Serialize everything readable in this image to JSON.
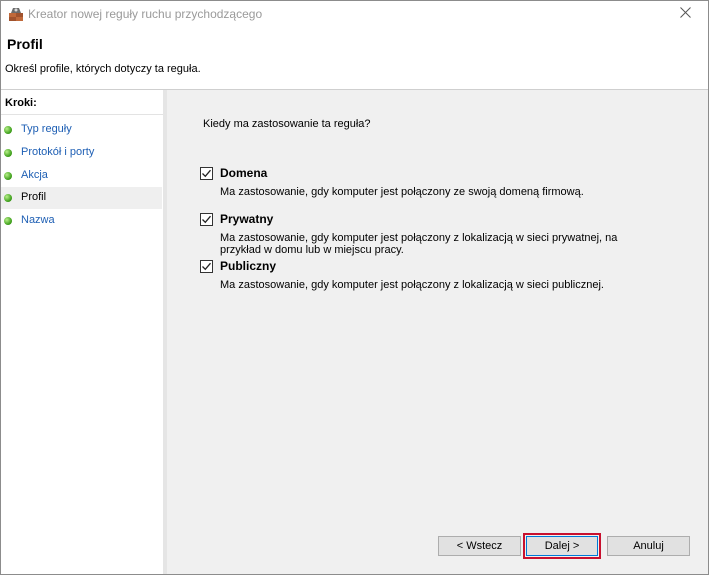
{
  "window": {
    "title": "Kreator nowej reguły ruchu przychodzącego",
    "app_icon": "firewall-icon",
    "close_icon": "close-icon"
  },
  "header": {
    "title": "Profil",
    "description": "Określ profile, których dotyczy ta reguła."
  },
  "steps": {
    "heading": "Kroki:",
    "items": [
      {
        "label": "Typ reguły",
        "active": false
      },
      {
        "label": "Protokół i porty",
        "active": false
      },
      {
        "label": "Akcja",
        "active": false
      },
      {
        "label": "Profil",
        "active": true
      },
      {
        "label": "Nazwa",
        "active": false
      }
    ]
  },
  "content": {
    "question": "Kiedy ma zastosowanie ta reguła?",
    "options": [
      {
        "label": "Domena",
        "checked": true,
        "description": "Ma zastosowanie, gdy komputer jest połączony ze swoją domeną firmową."
      },
      {
        "label": "Prywatny",
        "checked": true,
        "description": "Ma zastosowanie, gdy komputer jest połączony z lokalizacją w sieci prywatnej, na przykład w domu lub w miejscu pracy."
      },
      {
        "label": "Publiczny",
        "checked": true,
        "description": "Ma zastosowanie, gdy komputer jest połączony z lokalizacją w sieci publicznej."
      }
    ]
  },
  "buttons": {
    "back": "< Wstecz",
    "next": "Dalej >",
    "cancel": "Anuluj"
  },
  "colors": {
    "highlight_outline": "#c8102e",
    "link": "#1e5fb4",
    "step_dot": "#3fa01c"
  }
}
